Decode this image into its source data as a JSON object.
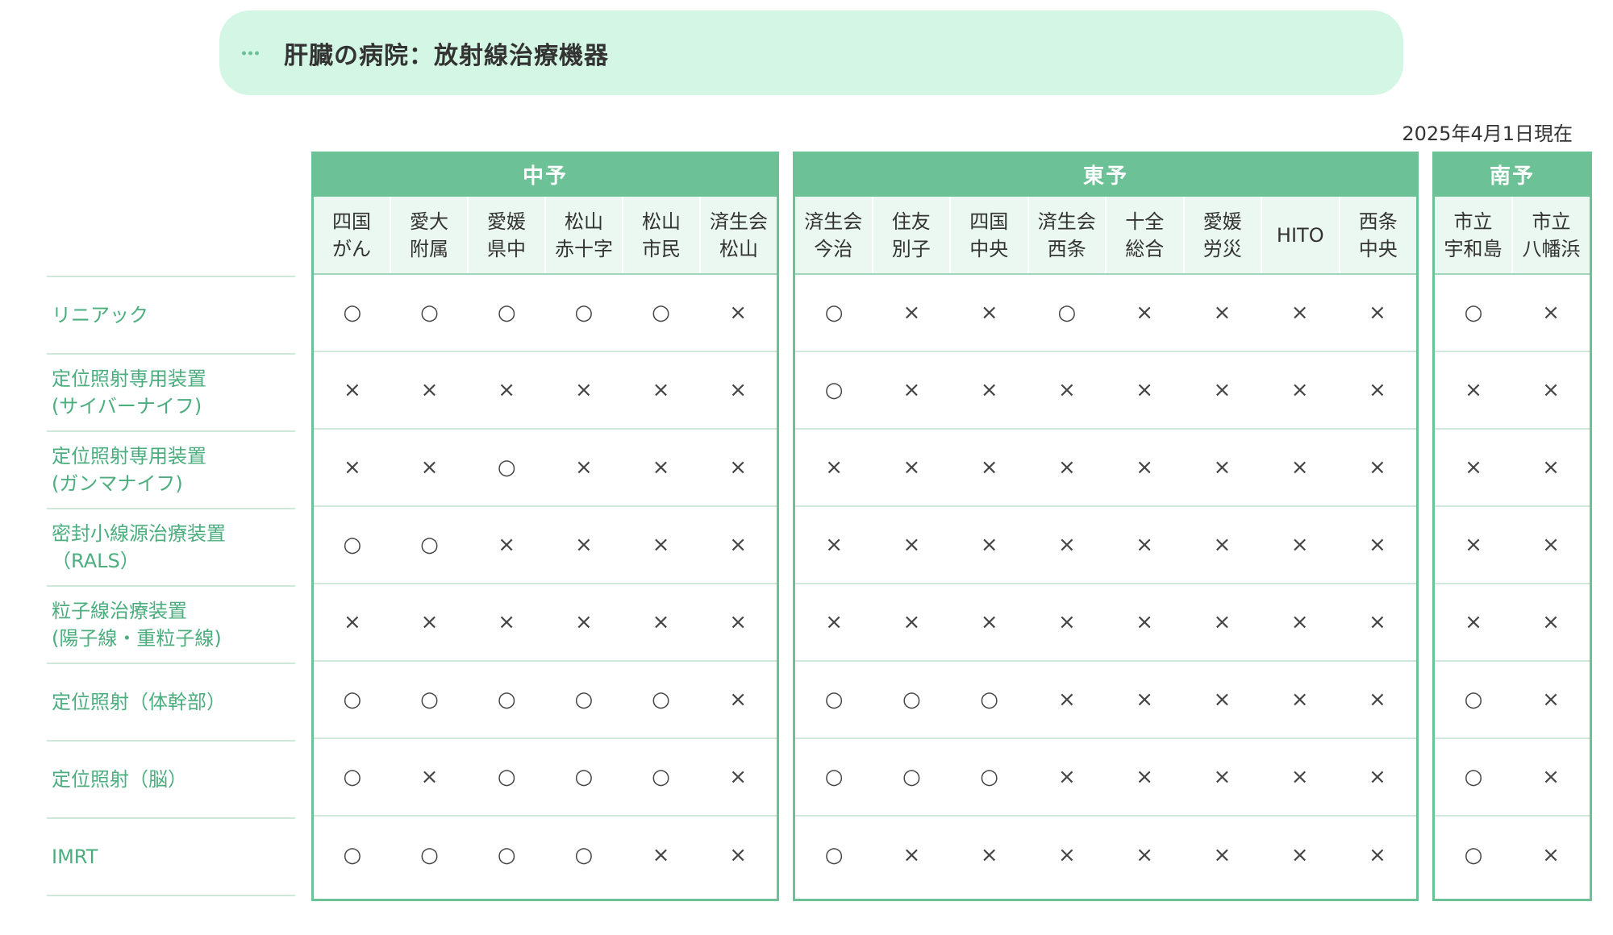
{
  "title": "肝臓の病院：放射線治療機器",
  "as_of": "2025年4月1日現在",
  "treatments": [
    "リニアック",
    "定位照射専用装置\n(サイバーナイフ)",
    "定位照射専用装置\n(ガンマナイフ)",
    "密封小線源治療装置\n（RALS）",
    "粒子線治療装置\n(陽子線・重粒子線)",
    "定位照射（体幹部）",
    "定位照射（脳）",
    "IMRT"
  ],
  "groups": [
    {
      "name": "中予",
      "hospitals": [
        "四国\nがん",
        "愛大\n附属",
        "愛媛\n県中",
        "松山\n赤十字",
        "松山\n市民",
        "済生会\n松山"
      ],
      "rows": [
        [
          "○",
          "○",
          "○",
          "○",
          "○",
          "×"
        ],
        [
          "×",
          "×",
          "×",
          "×",
          "×",
          "×"
        ],
        [
          "×",
          "×",
          "○",
          "×",
          "×",
          "×"
        ],
        [
          "○",
          "○",
          "×",
          "×",
          "×",
          "×"
        ],
        [
          "×",
          "×",
          "×",
          "×",
          "×",
          "×"
        ],
        [
          "○",
          "○",
          "○",
          "○",
          "○",
          "×"
        ],
        [
          "○",
          "×",
          "○",
          "○",
          "○",
          "×"
        ],
        [
          "○",
          "○",
          "○",
          "○",
          "×",
          "×"
        ]
      ]
    },
    {
      "name": "東予",
      "hospitals": [
        "済生会\n今治",
        "住友\n別子",
        "四国\n中央",
        "済生会\n西条",
        "十全\n総合",
        "愛媛\n労災",
        "HITO",
        "西条\n中央"
      ],
      "rows": [
        [
          "○",
          "×",
          "×",
          "○",
          "×",
          "×",
          "×",
          "×"
        ],
        [
          "○",
          "×",
          "×",
          "×",
          "×",
          "×",
          "×",
          "×"
        ],
        [
          "×",
          "×",
          "×",
          "×",
          "×",
          "×",
          "×",
          "×"
        ],
        [
          "×",
          "×",
          "×",
          "×",
          "×",
          "×",
          "×",
          "×"
        ],
        [
          "×",
          "×",
          "×",
          "×",
          "×",
          "×",
          "×",
          "×"
        ],
        [
          "○",
          "○",
          "○",
          "×",
          "×",
          "×",
          "×",
          "×"
        ],
        [
          "○",
          "○",
          "○",
          "×",
          "×",
          "×",
          "×",
          "×"
        ],
        [
          "○",
          "×",
          "×",
          "×",
          "×",
          "×",
          "×",
          "×"
        ]
      ]
    },
    {
      "name": "南予",
      "hospitals": [
        "市立\n宇和島",
        "市立\n八幡浜"
      ],
      "rows": [
        [
          "○",
          "×"
        ],
        [
          "×",
          "×"
        ],
        [
          "×",
          "×"
        ],
        [
          "×",
          "×"
        ],
        [
          "×",
          "×"
        ],
        [
          "○",
          "×"
        ],
        [
          "○",
          "×"
        ],
        [
          "○",
          "×"
        ]
      ]
    }
  ],
  "colors": {
    "banner_bg": "#d4f6e4",
    "accent_green": "#6cc196",
    "label_green": "#4cae7e",
    "header_cell_bg": "#ebf8f1"
  }
}
